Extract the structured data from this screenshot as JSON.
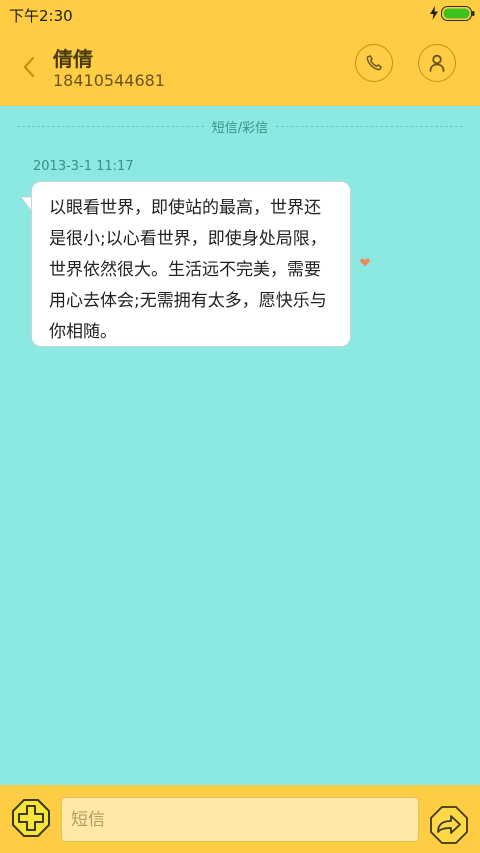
{
  "status_bar": {
    "time": "下午2:30",
    "icons": [
      "charging-bolt-icon",
      "battery-icon"
    ],
    "battery_color": "#3cc31e"
  },
  "header": {
    "back_icon": "chevron-left-icon",
    "contact_name": "倩倩",
    "contact_number": "18410544681",
    "call_icon": "phone-icon",
    "profile_icon": "person-icon",
    "background_color": "#ffcd44"
  },
  "thread": {
    "divider_label": "短信/彩信",
    "background_color": "#8ce9e1",
    "messages": [
      {
        "timestamp": "2013-3-1 11:17",
        "text": "以眼看世界，即使站的最高，世界还是很小;以心看世界，即使身处局限，世界依然很大。生活远不完美，需要用心去体会;无需拥有太多，愿快乐与你相随。",
        "indicator_icon": "heart-icon",
        "indicator_color": "#f08a5d"
      }
    ]
  },
  "composer": {
    "add_icon": "plus-icon",
    "placeholder": "短信",
    "send_icon": "send-arrow-icon"
  }
}
